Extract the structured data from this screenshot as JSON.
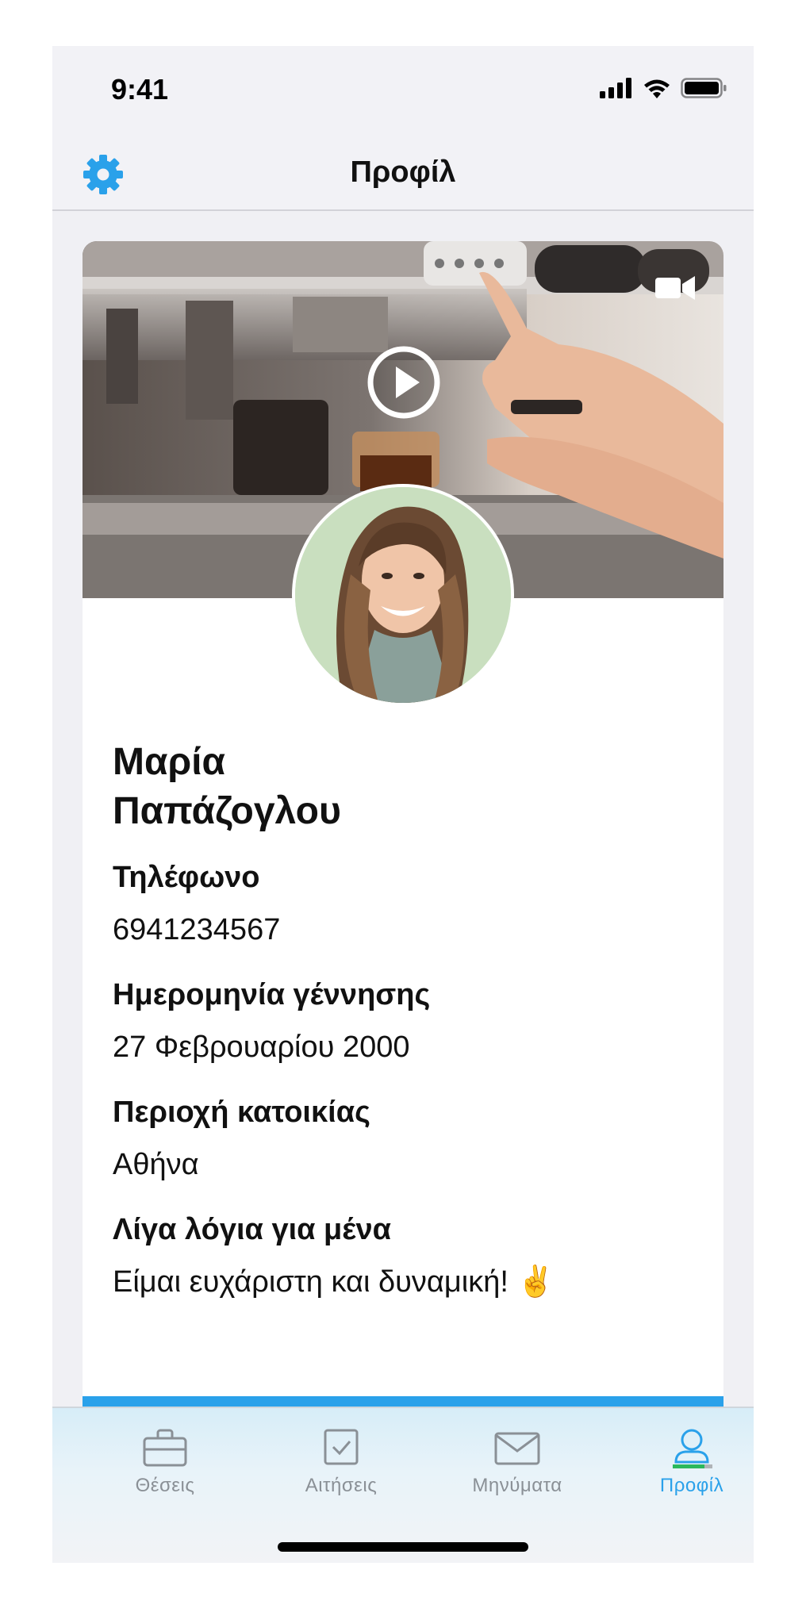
{
  "status": {
    "time": "9:41"
  },
  "header": {
    "title": "Προφίλ"
  },
  "profile": {
    "first_name": "Μαρία",
    "last_name": "Παπάζογλου",
    "fields": [
      {
        "label": "Τηλέφωνο",
        "value": "6941234567"
      },
      {
        "label": "Ημερομηνία γέννησης",
        "value": "27 Φεβρουαρίου 2000"
      },
      {
        "label": "Περιοχή κατοικίας",
        "value": "Αθήνα"
      },
      {
        "label": "Λίγα λόγια για μένα",
        "value": "Είμαι ευχάριστη και δυναμική! ✌️"
      }
    ]
  },
  "tabs": [
    {
      "label": "Θέσεις",
      "icon": "briefcase-icon"
    },
    {
      "label": "Αιτήσεις",
      "icon": "checkbox-icon"
    },
    {
      "label": "Μηνύματα",
      "icon": "envelope-icon"
    },
    {
      "label": "Προφίλ",
      "icon": "user-icon",
      "active": true
    }
  ],
  "colors": {
    "accent": "#2aa1ea",
    "tab_inactive": "#8a9096"
  }
}
